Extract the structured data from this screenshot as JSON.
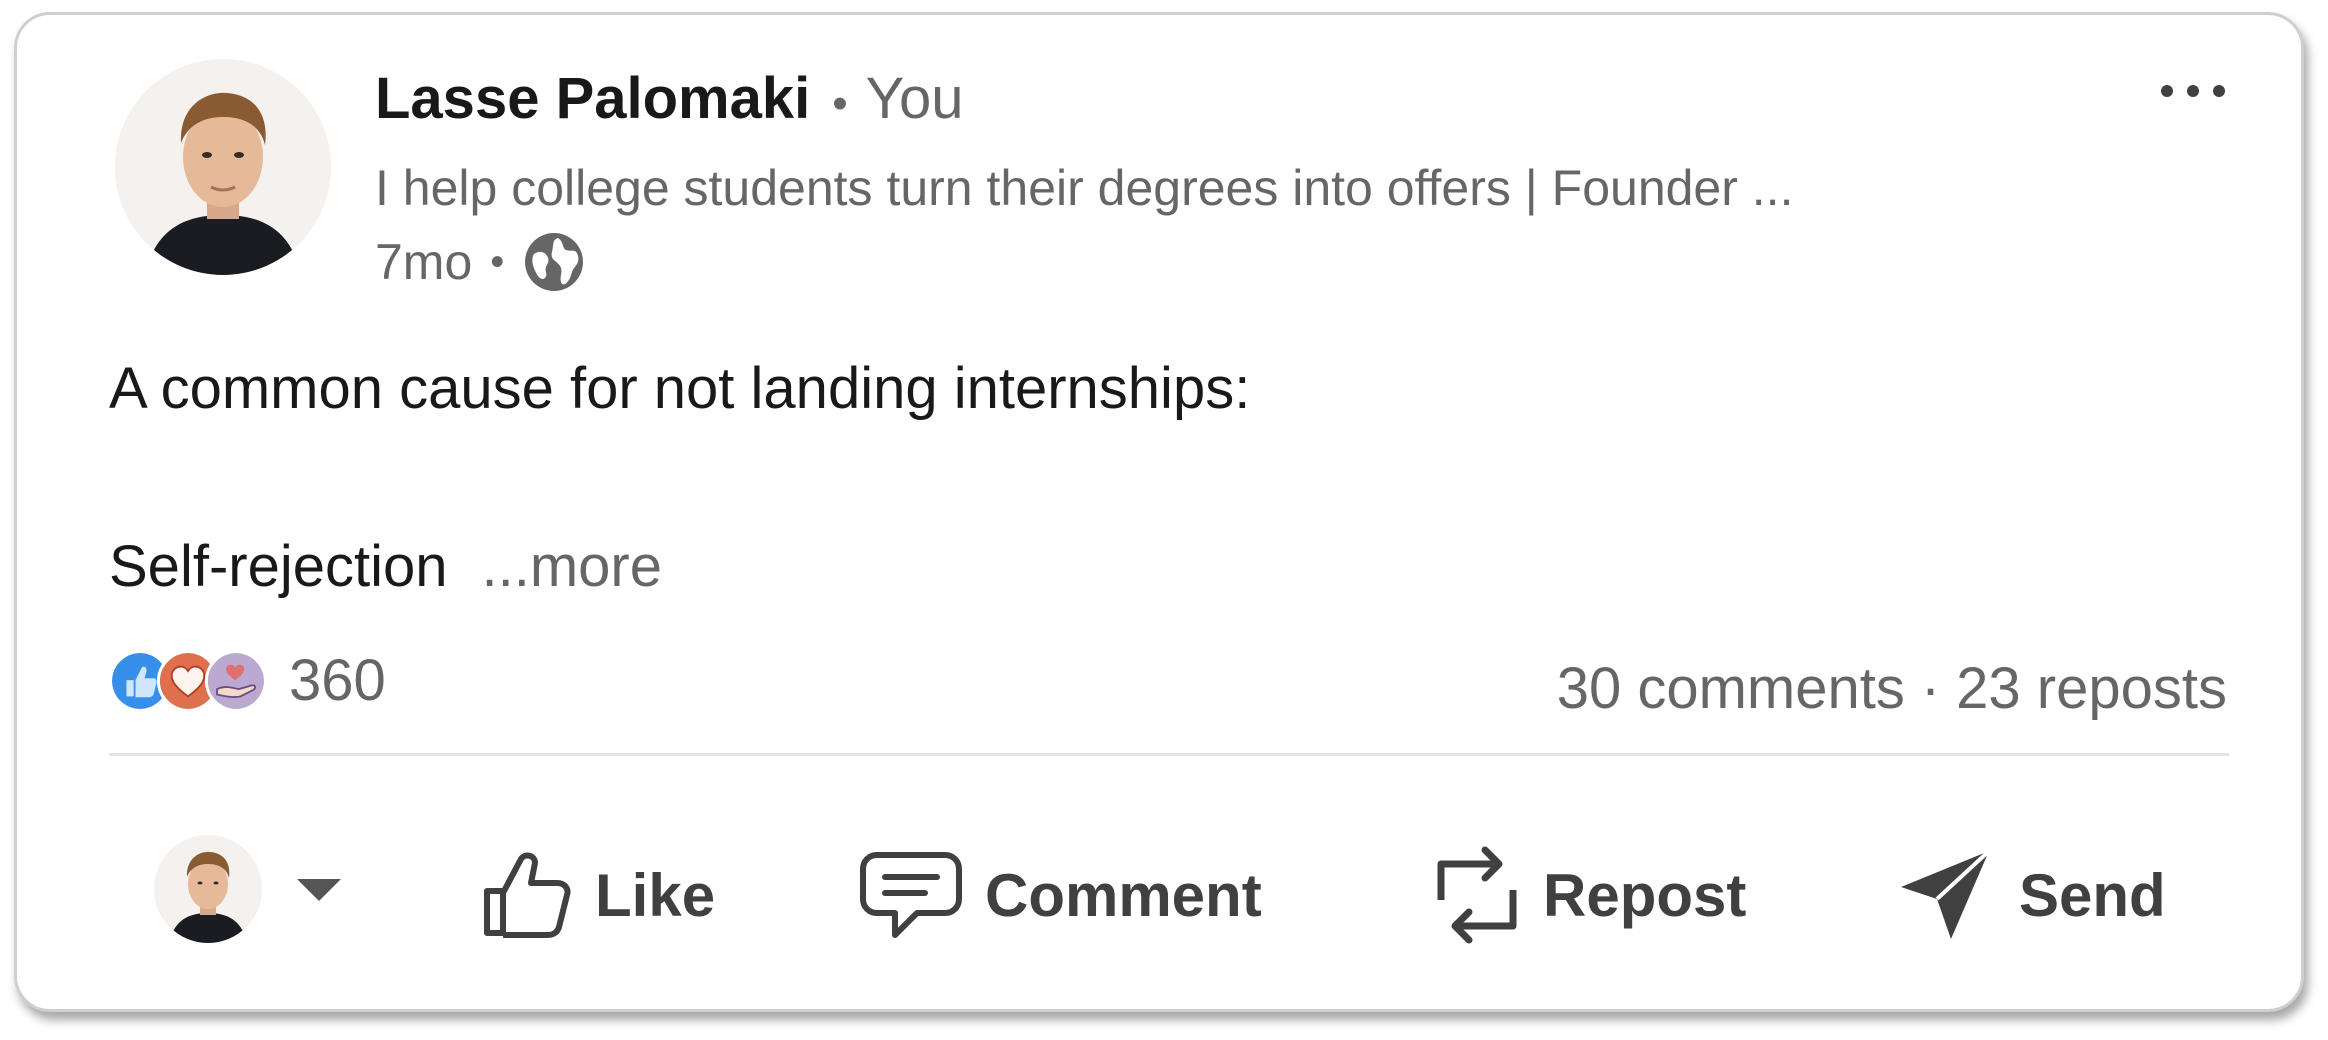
{
  "post": {
    "author_name": "Lasse Palomaki",
    "author_relation": "You",
    "author_headline": "I help college students turn their degrees into offers | Founder ...",
    "time_posted": "7mo",
    "visibility_icon": "globe-icon",
    "body_line1": "A common cause for not landing internships:",
    "body_line2": "Self-rejection",
    "see_more": "...more"
  },
  "social": {
    "reaction_icons": [
      "like-reaction-icon",
      "love-reaction-icon",
      "support-reaction-icon"
    ],
    "reaction_count": "360",
    "comments": "30 comments",
    "separator": "·",
    "reposts": "23 reposts"
  },
  "actions": {
    "like": "Like",
    "comment": "Comment",
    "repost": "Repost",
    "send": "Send"
  },
  "colors": {
    "primary_text": "#191919",
    "secondary_text": "#666666",
    "action_text": "#404040",
    "like_blue": "#378fe9",
    "love_red": "#df704d",
    "support_purple": "#bba9d1"
  }
}
